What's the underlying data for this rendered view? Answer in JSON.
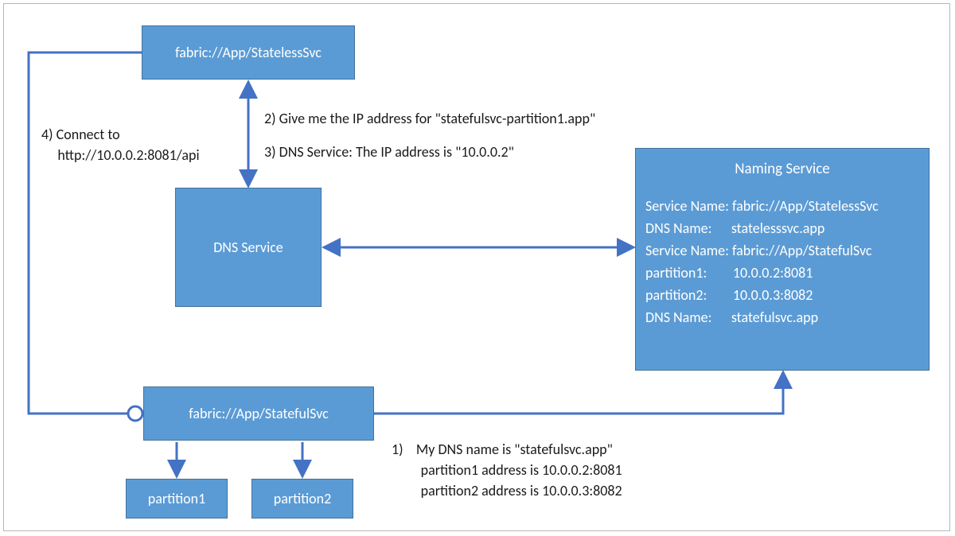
{
  "boxes": {
    "stateless": {
      "label": "fabric://App/StatelessSvc"
    },
    "dns": {
      "label": "DNS Service"
    },
    "stateful": {
      "label": "fabric://App/StatefulSvc"
    },
    "partition1": {
      "label": "partition1"
    },
    "partition2": {
      "label": "partition2"
    },
    "naming": {
      "title": "Naming Service",
      "lines": [
        "Service Name: fabric://App/StatelessSvc",
        "DNS Name:      statelesssvc.app",
        "",
        "Service Name: fabric://App/StatefulSvc",
        "partition1:        10.0.0.2:8081",
        "partition2:        10.0.0.3:8082",
        "DNS Name:      statefulsvc.app"
      ]
    }
  },
  "steps": {
    "s1": "1)    My DNS name is \"statefulsvc.app\"\n         partition1 address is 10.0.0.2:8081\n         partition2 address is 10.0.0.3:8082",
    "s2": "2) Give me the IP address for \"statefulsvc-partition1.app\"",
    "s3": "3) DNS Service: The IP address is \"10.0.0.2\"",
    "s4": "4) Connect to\n     http://10.0.0.2:8081/api"
  },
  "chart_data": {
    "type": "diagram",
    "nodes": [
      {
        "id": "stateless",
        "label": "fabric://App/StatelessSvc"
      },
      {
        "id": "dns",
        "label": "DNS Service"
      },
      {
        "id": "naming",
        "label": "Naming Service"
      },
      {
        "id": "stateful",
        "label": "fabric://App/StatefulSvc"
      },
      {
        "id": "partition1",
        "label": "partition1",
        "parent": "stateful"
      },
      {
        "id": "partition2",
        "label": "partition2",
        "parent": "stateful"
      }
    ],
    "edges": [
      {
        "from": "stateful",
        "to": "naming",
        "step": 1,
        "text": "My DNS name is \"statefulsvc.app\"; partition1 address is 10.0.0.2:8081; partition2 address is 10.0.0.3:8082",
        "kind": "unidirectional"
      },
      {
        "from": "stateless",
        "to": "dns",
        "step": 2,
        "text": "Give me the IP address for \"statefulsvc-partition1.app\"",
        "kind": "bidirectional"
      },
      {
        "from": "dns",
        "to": "stateless",
        "step": 3,
        "text": "DNS Service: The IP address is \"10.0.0.2\"",
        "kind": "bidirectional"
      },
      {
        "from": "stateless",
        "to": "stateful",
        "step": 4,
        "text": "Connect to http://10.0.0.2:8081/api",
        "kind": "unidirectional"
      },
      {
        "from": "dns",
        "to": "naming",
        "kind": "bidirectional"
      },
      {
        "from": "stateful",
        "to": "partition1",
        "kind": "unidirectional"
      },
      {
        "from": "stateful",
        "to": "partition2",
        "kind": "unidirectional"
      }
    ],
    "naming_service_contents": {
      "services": [
        {
          "service_name": "fabric://App/StatelessSvc",
          "dns_name": "statelesssvc.app"
        },
        {
          "service_name": "fabric://App/StatefulSvc",
          "dns_name": "statefulsvc.app",
          "partitions": [
            {
              "name": "partition1",
              "address": "10.0.0.2:8081"
            },
            {
              "name": "partition2",
              "address": "10.0.0.3:8082"
            }
          ]
        }
      ]
    }
  }
}
